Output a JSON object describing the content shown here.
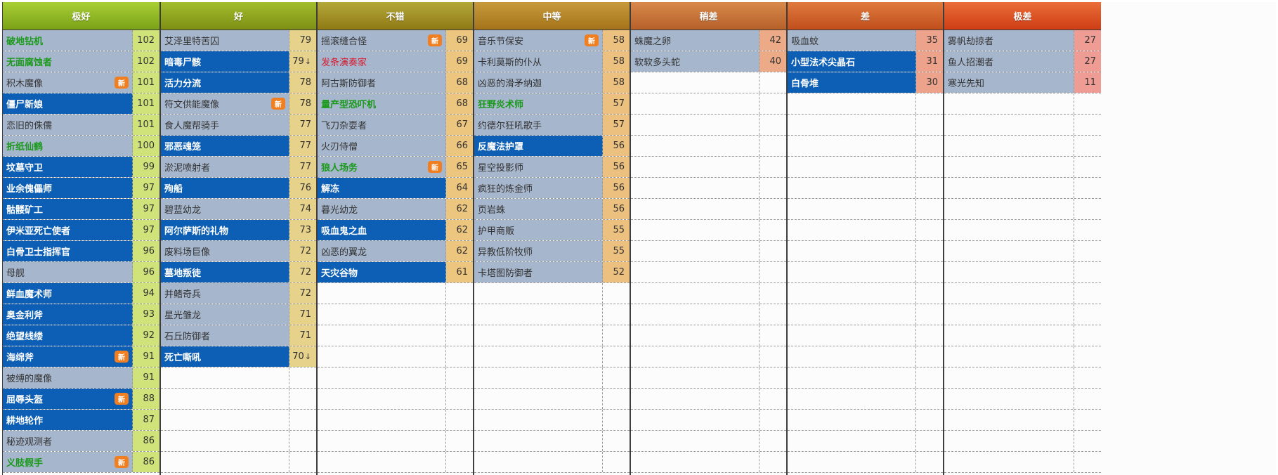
{
  "badge_text": "新",
  "columns": [
    {
      "id": "c1",
      "title": "极好",
      "header_gradient": [
        "#a8cf34",
        "#7ba218"
      ],
      "score_bg": "#cfe37a",
      "rows": [
        {
          "name": "破地钻机",
          "score": "102",
          "style": "green",
          "badge": false
        },
        {
          "name": "无面腐蚀者",
          "score": "102",
          "style": "green",
          "badge": false
        },
        {
          "name": "积木魔像",
          "score": "101",
          "style": "plain",
          "badge": true
        },
        {
          "name": "僵尸新娘",
          "score": "101",
          "style": "bold",
          "badge": false
        },
        {
          "name": "恋旧的侏儒",
          "score": "101",
          "style": "plain",
          "badge": false
        },
        {
          "name": "折纸仙鹤",
          "score": "100",
          "style": "green",
          "badge": false
        },
        {
          "name": "坟墓守卫",
          "score": "99",
          "style": "bold",
          "badge": false
        },
        {
          "name": "业余傀儡师",
          "score": "97",
          "style": "bold",
          "badge": false
        },
        {
          "name": "骷髅矿工",
          "score": "97",
          "style": "bold",
          "badge": false
        },
        {
          "name": "伊米亚死亡使者",
          "score": "97",
          "style": "bold",
          "badge": false
        },
        {
          "name": "白骨卫士指挥官",
          "score": "96",
          "style": "bold",
          "badge": false
        },
        {
          "name": "母舰",
          "score": "96",
          "style": "plain",
          "badge": false
        },
        {
          "name": "鲜血魔术师",
          "score": "94",
          "style": "bold",
          "badge": false
        },
        {
          "name": "奥金利斧",
          "score": "93",
          "style": "bold",
          "badge": false
        },
        {
          "name": "绝望线缕",
          "score": "92",
          "style": "bold",
          "badge": false
        },
        {
          "name": "海绵斧",
          "score": "91",
          "style": "bold",
          "badge": true
        },
        {
          "name": "被缚的魔像",
          "score": "91",
          "style": "plain",
          "badge": false
        },
        {
          "name": "屈辱头盔",
          "score": "88",
          "style": "bold",
          "badge": true
        },
        {
          "name": "耕地轮作",
          "score": "87",
          "style": "bold",
          "badge": false
        },
        {
          "name": "秘迹观测者",
          "score": "86",
          "style": "plain",
          "badge": false
        },
        {
          "name": "义肢假手",
          "score": "86",
          "style": "green",
          "badge": true
        }
      ]
    },
    {
      "id": "c2",
      "title": "好",
      "header_gradient": [
        "#a2bd2c",
        "#7e8f14"
      ],
      "score_bg": "#e6d28a",
      "rows": [
        {
          "name": "艾泽里特苦囚",
          "score": "79",
          "style": "plain",
          "badge": false
        },
        {
          "name": "暗毒尸骸",
          "score": "79",
          "arrow": "↓",
          "style": "bold",
          "badge": false
        },
        {
          "name": "活力分流",
          "score": "78",
          "style": "bold",
          "badge": false
        },
        {
          "name": "符文供能魔像",
          "score": "78",
          "style": "plain",
          "badge": true
        },
        {
          "name": "食人魔帮骑手",
          "score": "77",
          "style": "plain",
          "badge": false
        },
        {
          "name": "邪恶魂笼",
          "score": "77",
          "style": "bold",
          "badge": false
        },
        {
          "name": "淤泥喷射者",
          "score": "77",
          "style": "plain",
          "badge": false
        },
        {
          "name": "殉船",
          "score": "76",
          "style": "bold",
          "badge": false
        },
        {
          "name": "碧蓝幼龙",
          "score": "74",
          "style": "plain",
          "badge": false
        },
        {
          "name": "阿尔萨斯的礼物",
          "score": "73",
          "style": "bold",
          "badge": false
        },
        {
          "name": "废料场巨像",
          "score": "72",
          "style": "plain",
          "badge": false
        },
        {
          "name": "墓地叛徒",
          "score": "72",
          "style": "bold",
          "badge": false
        },
        {
          "name": "并鳍奇兵",
          "score": "72",
          "style": "plain",
          "badge": false
        },
        {
          "name": "星光雏龙",
          "score": "71",
          "style": "plain",
          "badge": false
        },
        {
          "name": "石丘防御者",
          "score": "71",
          "style": "plain",
          "badge": false
        },
        {
          "name": "死亡嘶吼",
          "score": "70",
          "arrow": "↓",
          "style": "bold",
          "badge": false
        }
      ]
    },
    {
      "id": "c3",
      "title": "不错",
      "header_gradient": [
        "#b4a83a",
        "#8f7a14"
      ],
      "score_bg": "#ecc57e",
      "rows": [
        {
          "name": "摇滚缝合怪",
          "score": "69",
          "style": "plain",
          "badge": true
        },
        {
          "name": "发条演奏家",
          "score": "69",
          "style": "red",
          "badge": false
        },
        {
          "name": "阿古斯防御者",
          "score": "68",
          "style": "plain",
          "badge": false
        },
        {
          "name": "量产型恐吓机",
          "score": "68",
          "style": "green",
          "badge": false
        },
        {
          "name": "飞刀杂耍者",
          "score": "67",
          "style": "plain",
          "badge": false
        },
        {
          "name": "火刃侍僧",
          "score": "66",
          "style": "plain",
          "badge": false
        },
        {
          "name": "狼人场务",
          "score": "65",
          "style": "green",
          "badge": true
        },
        {
          "name": "解冻",
          "score": "64",
          "style": "bold",
          "badge": false
        },
        {
          "name": "暮光幼龙",
          "score": "62",
          "style": "plain",
          "badge": false
        },
        {
          "name": "吸血鬼之血",
          "score": "62",
          "style": "bold",
          "badge": false
        },
        {
          "name": "凶恶的翼龙",
          "score": "62",
          "style": "plain",
          "badge": false
        },
        {
          "name": "天灾谷物",
          "score": "61",
          "style": "bold",
          "badge": false
        }
      ]
    },
    {
      "id": "c4",
      "title": "中等",
      "header_gradient": [
        "#c89a3c",
        "#a5741a"
      ],
      "score_bg": "#ecc07e",
      "rows": [
        {
          "name": "音乐节保安",
          "score": "58",
          "style": "plain",
          "badge": true
        },
        {
          "name": "卡利莫斯的仆从",
          "score": "58",
          "style": "plain",
          "badge": false
        },
        {
          "name": "凶恶的滑矛纳迦",
          "score": "58",
          "style": "plain",
          "badge": false
        },
        {
          "name": "狂野炎术师",
          "score": "57",
          "style": "green",
          "badge": false
        },
        {
          "name": "约德尔狂吼歌手",
          "score": "57",
          "style": "plain",
          "badge": false
        },
        {
          "name": "反魔法护罩",
          "score": "56",
          "style": "bold",
          "badge": false
        },
        {
          "name": "星空投影师",
          "score": "56",
          "style": "plain",
          "badge": false
        },
        {
          "name": "疯狂的炼金师",
          "score": "56",
          "style": "plain",
          "badge": false
        },
        {
          "name": "页岩蛛",
          "score": "56",
          "style": "plain",
          "badge": false
        },
        {
          "name": "护甲商贩",
          "score": "55",
          "style": "plain",
          "badge": false
        },
        {
          "name": "异教低阶牧师",
          "score": "55",
          "style": "plain",
          "badge": false
        },
        {
          "name": "卡塔图防御者",
          "score": "52",
          "style": "plain",
          "badge": false
        }
      ]
    },
    {
      "id": "c5",
      "title": "稍差",
      "header_gradient": [
        "#d8894a",
        "#b6602a"
      ],
      "score_bg": "#edaa86",
      "rows": [
        {
          "name": "蛛魔之卵",
          "score": "42",
          "style": "plain",
          "badge": false
        },
        {
          "name": "软软多头蛇",
          "score": "40",
          "style": "plain",
          "badge": false
        }
      ]
    },
    {
      "id": "c6",
      "title": "差",
      "header_gradient": [
        "#e07a3e",
        "#c04e1c"
      ],
      "score_bg": "#eda28c",
      "rows": [
        {
          "name": "吸血蚊",
          "score": "35",
          "style": "plain",
          "badge": false
        },
        {
          "name": "小型法术尖晶石",
          "score": "31",
          "style": "bold",
          "badge": false
        },
        {
          "name": "白骨堆",
          "score": "30",
          "style": "bold",
          "badge": false
        }
      ]
    },
    {
      "id": "c7",
      "title": "极差",
      "header_gradient": [
        "#ea6d38",
        "#cf3d14"
      ],
      "score_bg": "#ee9c94",
      "rows": [
        {
          "name": "雾帆劫掠者",
          "score": "27",
          "style": "plain",
          "badge": false
        },
        {
          "name": "鱼人招潮者",
          "score": "27",
          "style": "plain",
          "badge": false
        },
        {
          "name": "寒光先知",
          "score": "11",
          "style": "plain",
          "badge": false
        }
      ]
    }
  ]
}
